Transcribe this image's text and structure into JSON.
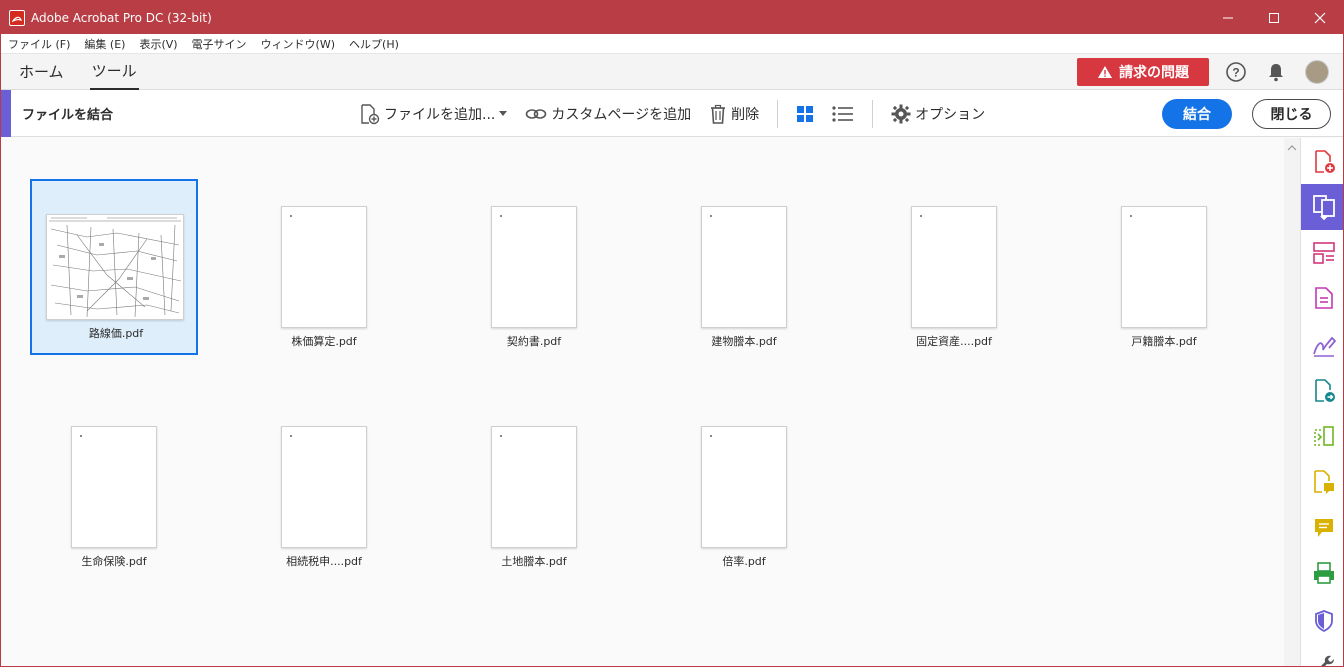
{
  "app": {
    "title": "Adobe Acrobat Pro DC (32-bit)",
    "menu": [
      "ファイル (F)",
      "編集 (E)",
      "表示(V)",
      "電子サイン",
      "ウィンドウ(W)",
      "ヘルプ(H)"
    ],
    "tabs": [
      "ホーム",
      "ツール"
    ],
    "alert_label": "請求の問題"
  },
  "toolbar": {
    "title": "ファイルを結合",
    "add_files": "ファイルを追加...",
    "add_custom_page": "カスタムページを追加",
    "delete": "削除",
    "options": "オプション",
    "combine": "結合",
    "close": "閉じる"
  },
  "files": [
    {
      "name": "路線価.pdf",
      "selected": true
    },
    {
      "name": "株価算定.pdf"
    },
    {
      "name": "契約書.pdf"
    },
    {
      "name": "建物謄本.pdf"
    },
    {
      "name": "固定資産....pdf"
    },
    {
      "name": "戸籍謄本.pdf"
    },
    {
      "name": "生命保険.pdf"
    },
    {
      "name": "相続税申....pdf"
    },
    {
      "name": "土地謄本.pdf"
    },
    {
      "name": "倍率.pdf"
    }
  ],
  "colors": {
    "titlebar": "#b93d45",
    "accent": "#6a5fd6",
    "primary": "#1473e6",
    "alert": "#d7373f"
  }
}
